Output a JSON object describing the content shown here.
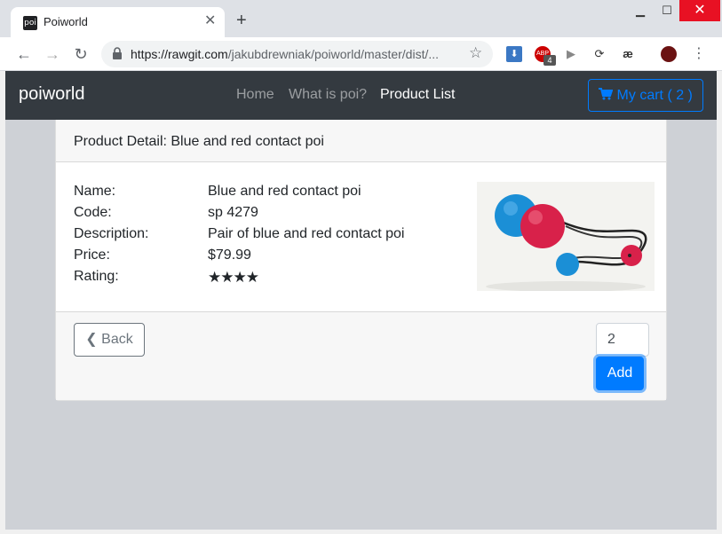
{
  "browser": {
    "tab_title": "Poiworld",
    "tab_favicon": "poi",
    "url_host": "https://rawgit.com",
    "url_path": "/jakubdrewniak/poiworld/master/dist/...",
    "extension_badge": "4"
  },
  "navbar": {
    "brand": "poiworld",
    "links": [
      {
        "label": "Home"
      },
      {
        "label": "What is poi?"
      },
      {
        "label": "Product List"
      }
    ],
    "cart_label": "My cart ( 2 )"
  },
  "card": {
    "header": "Product Detail: Blue and red contact poi",
    "fields": [
      {
        "label": "Name:",
        "value": "Blue and red contact poi"
      },
      {
        "label": "Code:",
        "value": "sp 4279"
      },
      {
        "label": "Description:",
        "value": "Pair of blue and red contact poi"
      },
      {
        "label": "Price:",
        "value": "$79.99"
      },
      {
        "label": "Rating:",
        "value": ""
      }
    ],
    "rating_stars": "★★★★",
    "rating": 4,
    "back_label": "Back",
    "quantity": "2",
    "add_label": "Add"
  },
  "colors": {
    "navbar_bg": "#343a40",
    "primary": "#007bff",
    "secondary": "#6c757d"
  }
}
